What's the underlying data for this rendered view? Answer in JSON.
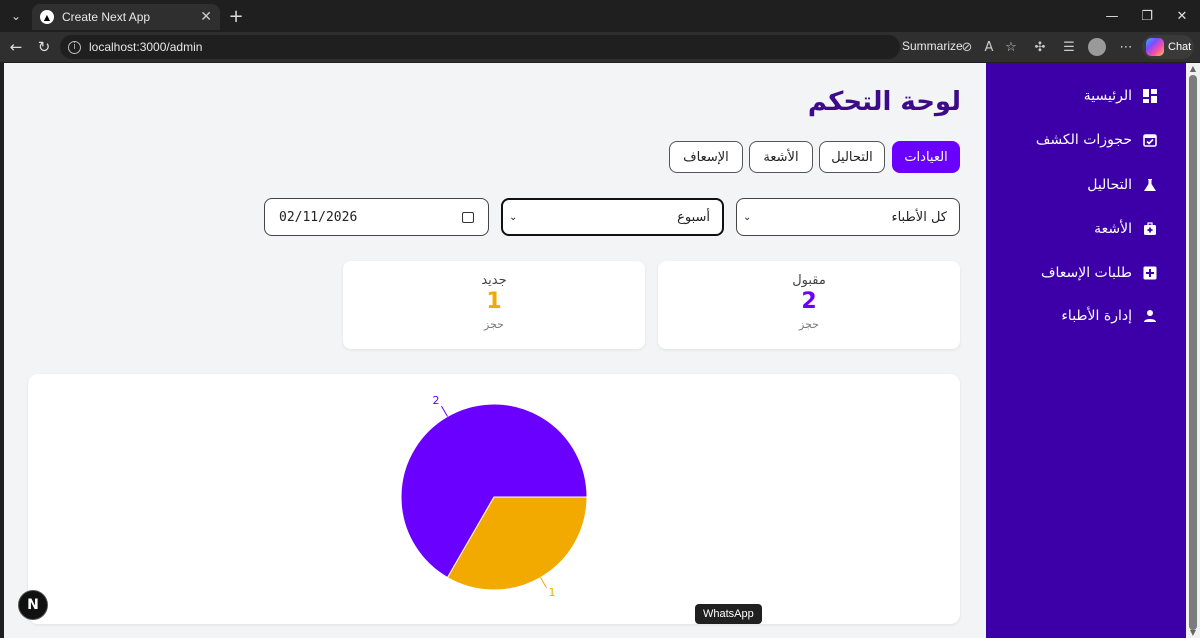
{
  "browser": {
    "tab_title": "Create Next App",
    "url": "localhost:3000/admin",
    "summarize_label": "Summarize",
    "chat_label": "Chat"
  },
  "sidebar": {
    "items": [
      {
        "label": "الرئيسية",
        "icon": "dashboard-icon"
      },
      {
        "label": "حجوزات الكشف",
        "icon": "calendar-check-icon"
      },
      {
        "label": "التحاليل",
        "icon": "flask-icon"
      },
      {
        "label": "الأشعة",
        "icon": "medical-bag-icon"
      },
      {
        "label": "طلبات الإسعاف",
        "icon": "plus-box-icon"
      },
      {
        "label": "إدارة الأطباء",
        "icon": "person-icon"
      }
    ]
  },
  "main": {
    "title": "لوحة التحكم",
    "tabs": [
      {
        "label": "العيادات",
        "active": true
      },
      {
        "label": "التحاليل",
        "active": false
      },
      {
        "label": "الأشعة",
        "active": false
      },
      {
        "label": "الإسعاف",
        "active": false
      }
    ],
    "filters": {
      "doctor_select": "كل الأطباء",
      "period_select": "أسبوع",
      "date_value": "02/11/2026"
    },
    "stats": [
      {
        "label": "مقبول",
        "value": "2",
        "unit": "حجز",
        "color": "#6a00ff"
      },
      {
        "label": "جديد",
        "value": "1",
        "unit": "حجز",
        "color": "#f2a900"
      }
    ]
  },
  "chart_data": {
    "type": "pie",
    "slices": [
      {
        "label": "2",
        "value": 2,
        "color": "#6a00ff"
      },
      {
        "label": "1",
        "value": 1,
        "color": "#f2a900"
      }
    ]
  },
  "overlay": {
    "tooltip": "WhatsApp",
    "next_badge": "N"
  }
}
